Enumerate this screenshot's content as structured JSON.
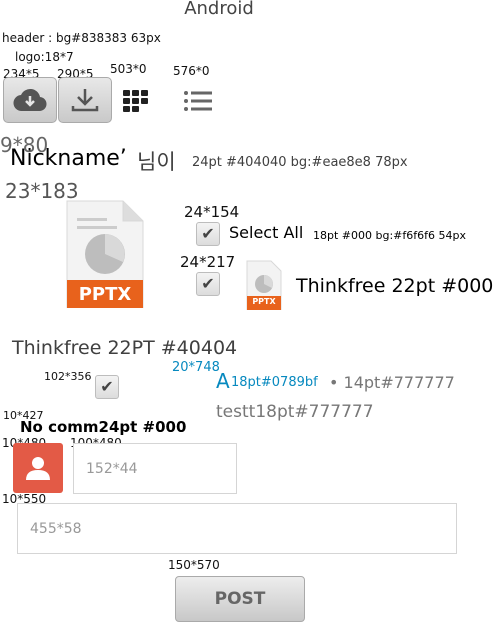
{
  "title": "Android",
  "notes": {
    "header": "header : bg#838383  63px",
    "logo": "logo:18*7",
    "c234": "234*5",
    "c290": "290*5",
    "c503": "503*0",
    "c576": "576*0",
    "c980": "9*80",
    "c23_183": "23*183",
    "c24_154": "24*154",
    "c24_217": "24*217",
    "c102_356": "102*356",
    "c20_748": "20*748",
    "c10_427": "10*427",
    "c10_480": "10*480",
    "c100_480": "100*480",
    "c10_550": "10*550",
    "c150_570": "150*570"
  },
  "nickname": {
    "name": "Nickname’",
    "suffix": "님이",
    "spec": "24pt #404040  bg:#eae8e8  78px"
  },
  "select_all": {
    "label": "Select All",
    "spec": "18pt #000  bg:#f6f6f6  54px"
  },
  "file_big": {
    "badge": "PPTX"
  },
  "file_small": {
    "badge": "PPTX"
  },
  "file_name": "Thinkfree 22pt #000",
  "file_name_2": "Thinkfree 22PT #40404",
  "comment": {
    "author": "A",
    "author_spec": "18pt#0789bf",
    "meta": "• 14pt#777777",
    "text": "testt18pt#777777"
  },
  "no_comment": "No comm24pt #000",
  "inputs": {
    "small_placeholder": "152*44",
    "large_placeholder": "455*58"
  },
  "post_label": "POST",
  "icons": {
    "cloud": "cloud-download-icon",
    "download": "download-icon",
    "grid": "grid-icon",
    "list": "list-icon",
    "avatar": "user-icon"
  },
  "colors": {
    "header_bg": "#838383",
    "nickname": "#404040",
    "author": "#0789bf",
    "meta": "#777777",
    "avatar_bg": "#e35a46",
    "pptx": "#e8621c"
  }
}
